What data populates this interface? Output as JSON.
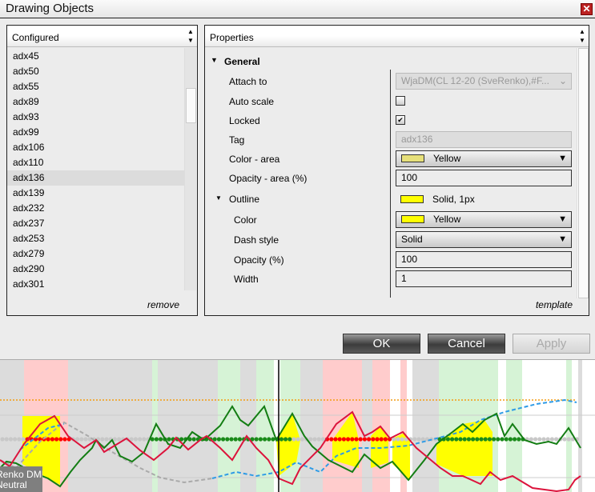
{
  "window": {
    "title": "Drawing Objects",
    "close_icon": "close-x"
  },
  "configured": {
    "header": "Configured",
    "items": [
      "adx45",
      "adx50",
      "adx55",
      "adx89",
      "adx93",
      "adx99",
      "adx106",
      "adx110",
      "adx136",
      "adx139",
      "adx232",
      "adx237",
      "adx253",
      "adx279",
      "adx290",
      "adx301"
    ],
    "selected": "adx136",
    "remove_link": "remove"
  },
  "properties": {
    "header": "Properties",
    "general": {
      "section": "General",
      "attach_to": {
        "label": "Attach to",
        "value": "WjaDM(CL 12-20 (SveRenko),#F..."
      },
      "auto_scale": {
        "label": "Auto scale",
        "checked": false
      },
      "locked": {
        "label": "Locked",
        "checked": true,
        "mark": "✔"
      },
      "tag": {
        "label": "Tag",
        "value": "adx136"
      },
      "color_area": {
        "label": "Color - area",
        "value": "Yellow",
        "swatch": "#e6e07a"
      },
      "opacity_area": {
        "label": "Opacity - area (%)",
        "value": "100"
      }
    },
    "outline": {
      "section": "Outline",
      "summary": "Solid, 1px",
      "swatch": "#ffff00",
      "color": {
        "label": "Color",
        "value": "Yellow"
      },
      "dash_style": {
        "label": "Dash style",
        "value": "Solid"
      },
      "opacity": {
        "label": "Opacity (%)",
        "value": "100"
      },
      "width": {
        "label": "Width",
        "value": "1"
      }
    },
    "template_link": "template"
  },
  "buttons": {
    "ok": "OK",
    "cancel": "Cancel",
    "apply": "Apply"
  },
  "chart": {
    "indicator_label": "Renko DMI",
    "state_label": "Neutral"
  }
}
